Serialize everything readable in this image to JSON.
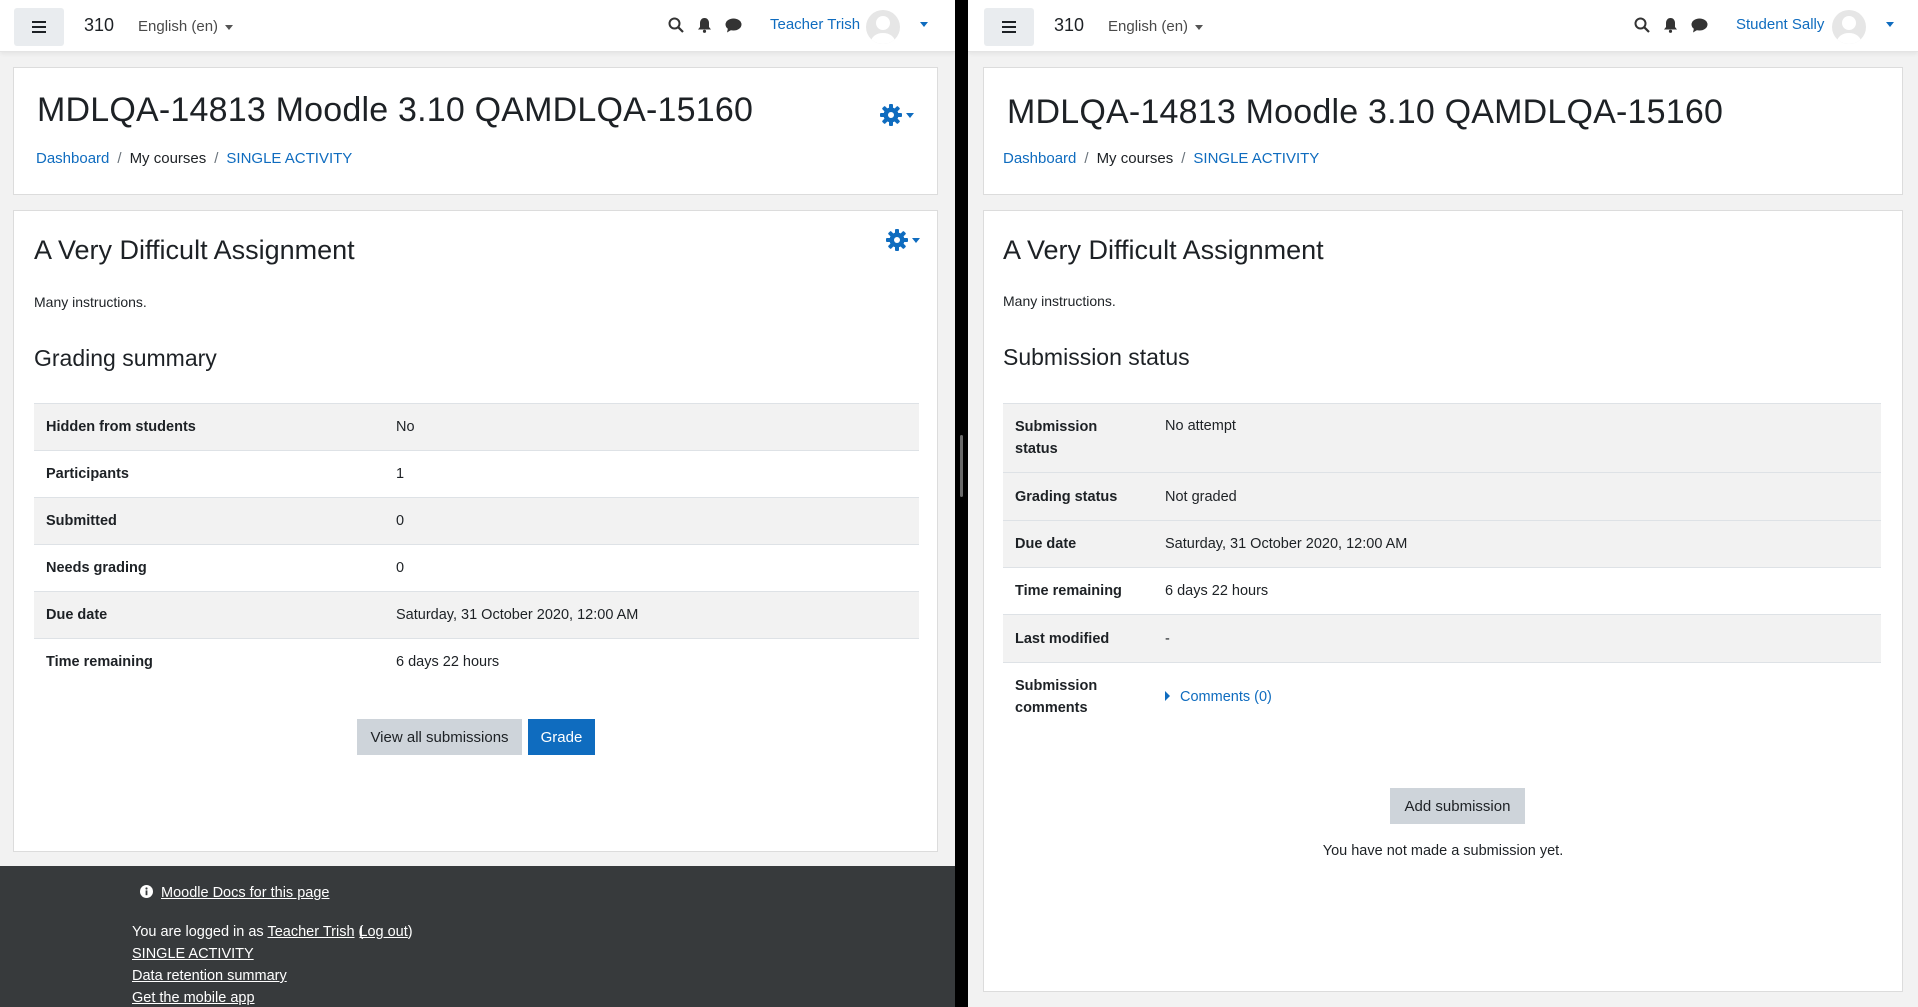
{
  "left": {
    "navbar": {
      "site_name": "310",
      "language": "English (en)",
      "user_name": "Teacher Trish"
    },
    "header": {
      "title": "MDLQA-14813 Moodle 3.10 QAMDLQA-15160",
      "breadcrumb": [
        "Dashboard",
        "My courses",
        "SINGLE ACTIVITY"
      ]
    },
    "assignment": {
      "title": "A Very Difficult Assignment",
      "intro": "Many instructions.",
      "section_title": "Grading summary",
      "rows": [
        {
          "label": "Hidden from students",
          "value": "No"
        },
        {
          "label": "Participants",
          "value": "1"
        },
        {
          "label": "Submitted",
          "value": "0"
        },
        {
          "label": "Needs grading",
          "value": "0"
        },
        {
          "label": "Due date",
          "value": "Saturday, 31 October 2020, 12:00 AM"
        },
        {
          "label": "Time remaining",
          "value": "6 days 22 hours"
        }
      ],
      "view_all_label": "View all submissions",
      "grade_label": "Grade"
    },
    "footer": {
      "docs_link": "Moodle Docs for this page",
      "logged_in_prefix": "You are logged in as",
      "logged_in_user": "Teacher Trish",
      "logout": "Log out",
      "course_link": "SINGLE ACTIVITY",
      "data_retention": "Data retention summary",
      "mobile_app": "Get the mobile app"
    }
  },
  "right": {
    "navbar": {
      "site_name": "310",
      "language": "English (en)",
      "user_name": "Student Sally"
    },
    "header": {
      "title": "MDLQA-14813 Moodle 3.10 QAMDLQA-15160",
      "breadcrumb": [
        "Dashboard",
        "My courses",
        "SINGLE ACTIVITY"
      ]
    },
    "assignment": {
      "title": "A Very Difficult Assignment",
      "intro": "Many instructions.",
      "section_title": "Submission status",
      "rows": [
        {
          "label_line1": "Submission",
          "label_line2": "status",
          "value": "No attempt"
        },
        {
          "label": "Grading status",
          "value": "Not graded"
        },
        {
          "label": "Due date",
          "value": "Saturday, 31 October 2020, 12:00 AM"
        },
        {
          "label": "Time remaining",
          "value": "6 days 22 hours"
        },
        {
          "label": "Last modified",
          "value": "-"
        },
        {
          "label_line1": "Submission",
          "label_line2": "comments",
          "value": "Comments (0)"
        }
      ],
      "add_submission_label": "Add submission",
      "no_submission_text": "You have not made a submission yet."
    }
  },
  "colors": {
    "accent": "#0f6cbf",
    "footer_bg": "#373a3c",
    "page_bg": "#f2f2f2"
  }
}
